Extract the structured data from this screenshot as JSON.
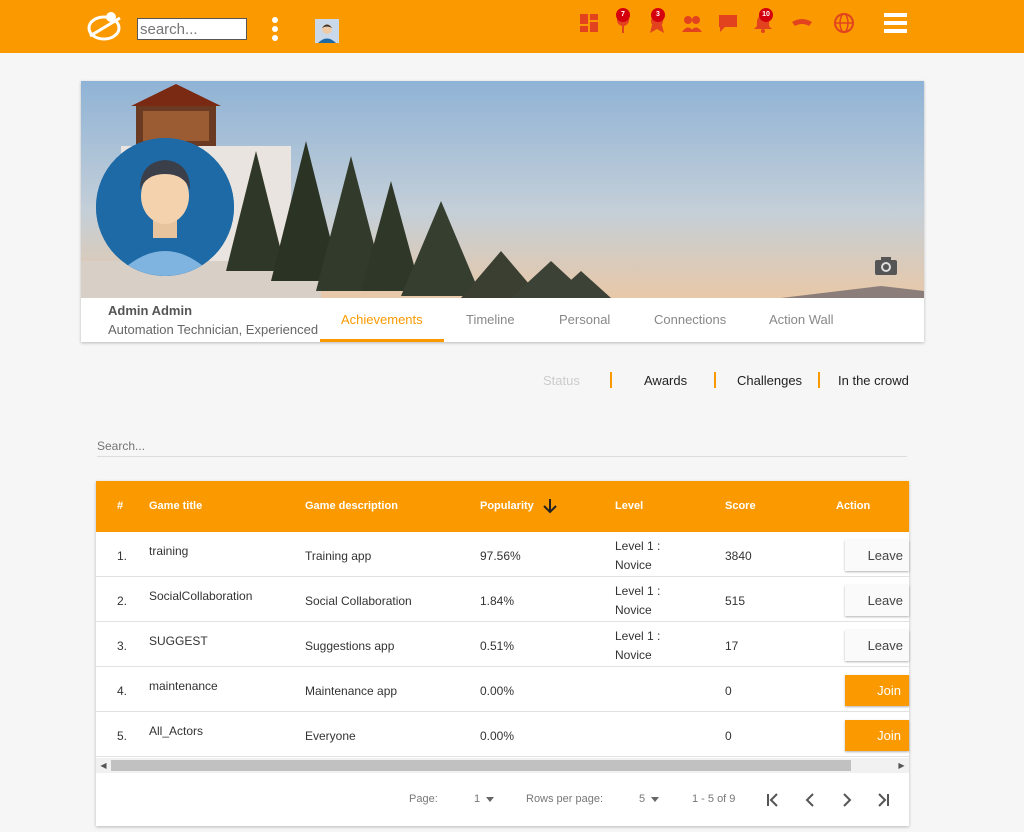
{
  "topbar": {
    "search_placeholder": "search...",
    "badges": {
      "pin": "7",
      "award": "3",
      "notifications": "10"
    },
    "colors": {
      "accent": "#fb9a00",
      "badge": "#d5000d"
    }
  },
  "profile": {
    "name": "Admin Admin",
    "role": "Automation Technician, Experienced",
    "tabs": [
      "Achievements",
      "Timeline",
      "Personal",
      "Connections",
      "Action Wall"
    ],
    "active_tab": "Achievements"
  },
  "subtabs": [
    "Status",
    "Awards",
    "Challenges",
    "In the crowd"
  ],
  "table": {
    "search_placeholder": "Search...",
    "columns": [
      "#",
      "Game title",
      "Game description",
      "Popularity",
      "Level",
      "Score",
      "Action"
    ],
    "rows": [
      {
        "num": "1.",
        "title": "training",
        "description": "Training app",
        "popularity": "97.56%",
        "level1": "Level 1 :",
        "level2": "Novice",
        "score": "3840",
        "action": "Leave"
      },
      {
        "num": "2.",
        "title": "SocialCollaboration",
        "description": "Social Collaboration",
        "popularity": "1.84%",
        "level1": "Level 1 :",
        "level2": "Novice",
        "score": "515",
        "action": "Leave"
      },
      {
        "num": "3.",
        "title": "SUGGEST",
        "description": "Suggestions app",
        "popularity": "0.51%",
        "level1": "Level 1 :",
        "level2": "Novice",
        "score": "17",
        "action": "Leave"
      },
      {
        "num": "4.",
        "title": "maintenance",
        "description": "Maintenance app",
        "popularity": "0.00%",
        "level1": "",
        "level2": "",
        "score": "0",
        "action": "Join"
      },
      {
        "num": "5.",
        "title": "All_Actors",
        "description": "Everyone",
        "popularity": "0.00%",
        "level1": "",
        "level2": "",
        "score": "0",
        "action": "Join"
      }
    ],
    "footer": {
      "page_label": "Page:",
      "page_value": "1",
      "rows_label": "Rows per page:",
      "rows_value": "5",
      "range": "1 - 5 of 9"
    }
  }
}
